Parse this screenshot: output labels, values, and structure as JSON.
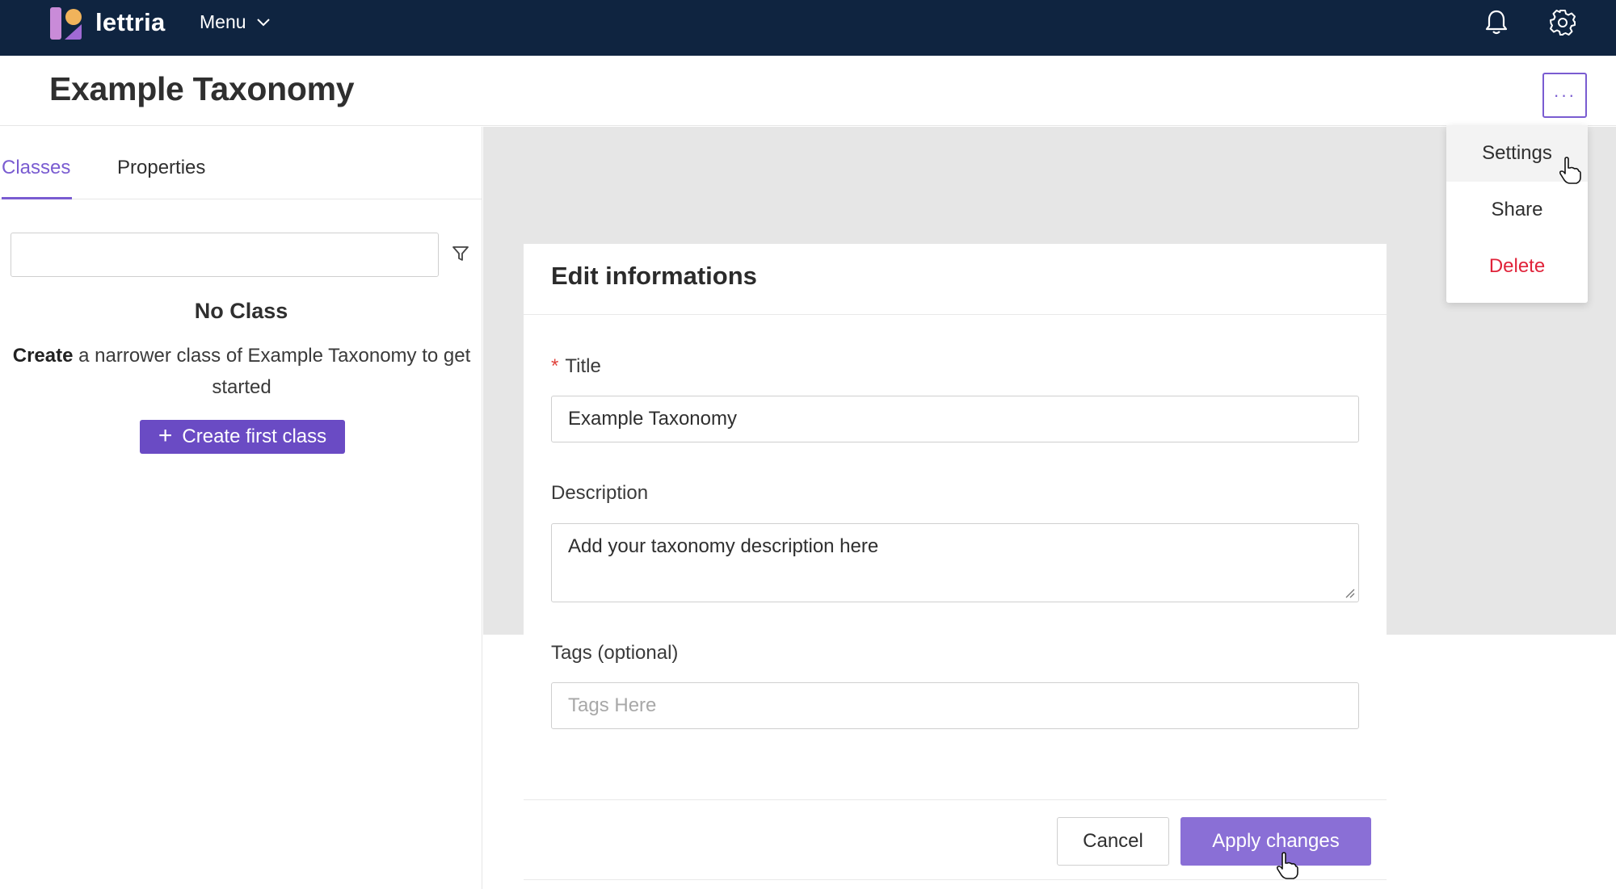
{
  "app": {
    "brand": "lettria",
    "menu_label": "Menu"
  },
  "header": {
    "title": "Example Taxonomy",
    "more_label": "···"
  },
  "left_panel": {
    "tabs": [
      {
        "label": "Classes",
        "active": true
      },
      {
        "label": "Properties",
        "active": false
      }
    ],
    "search": {
      "value": ""
    },
    "empty_title": "No Class",
    "empty_desc_bold": "Create",
    "empty_desc_rest": " a narrower class of Example Taxonomy to get started",
    "create_button": "Create first class"
  },
  "modal": {
    "title": "Edit informations",
    "title_field": {
      "required_mark": "*",
      "label": "Title",
      "value": "Example Taxonomy"
    },
    "description_field": {
      "label": "Description",
      "value": "Add your taxonomy description here"
    },
    "tags_field": {
      "label": "Tags (optional)",
      "placeholder": "Tags Here"
    },
    "cancel_label": "Cancel",
    "apply_label": "Apply changes"
  },
  "dropdown": {
    "items": [
      {
        "label": "Settings",
        "hovered": true
      },
      {
        "label": "Share"
      },
      {
        "label": "Delete",
        "danger": true
      }
    ]
  },
  "colors": {
    "nav_bg": "#0f2440",
    "accent": "#7a5cd1",
    "primary_button": "#6a4bc4",
    "danger": "#e0233a"
  },
  "icons": [
    "logo-icon",
    "chevron-down-icon",
    "bell-icon",
    "gear-icon",
    "filter-icon",
    "plus-icon",
    "resize-handle-icon",
    "pointer-cursor-icon"
  ]
}
